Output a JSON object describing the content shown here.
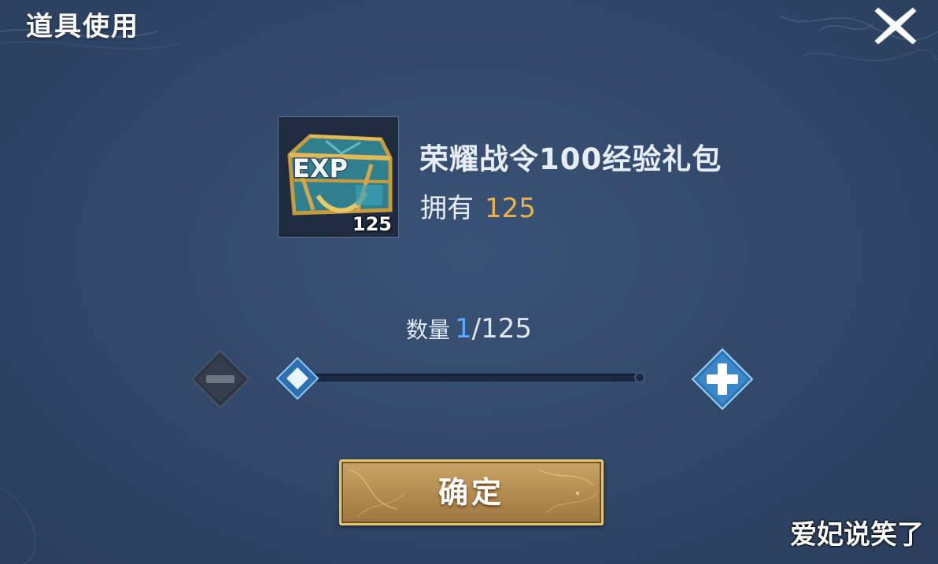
{
  "dialog": {
    "title": "道具使用",
    "close_icon": "close-icon"
  },
  "item": {
    "name": "荣耀战令100经验礼包",
    "icon": "exp-chest-icon",
    "icon_text": "EXP",
    "stack_count": "125",
    "owned_label": "拥有",
    "owned_value": "125"
  },
  "quantity": {
    "label": "数量",
    "current": "1",
    "max_text": "/125",
    "slider_fraction": 0.0
  },
  "controls": {
    "minus_icon": "minus-icon",
    "plus_icon": "plus-icon"
  },
  "confirm": {
    "label": "确定"
  },
  "watermark": "爱妃说笑了",
  "colors": {
    "background": "#334a6c",
    "accent_gold": "#e9b24a",
    "accent_blue": "#5aa8ff",
    "button_gold": "#b38a4e"
  }
}
